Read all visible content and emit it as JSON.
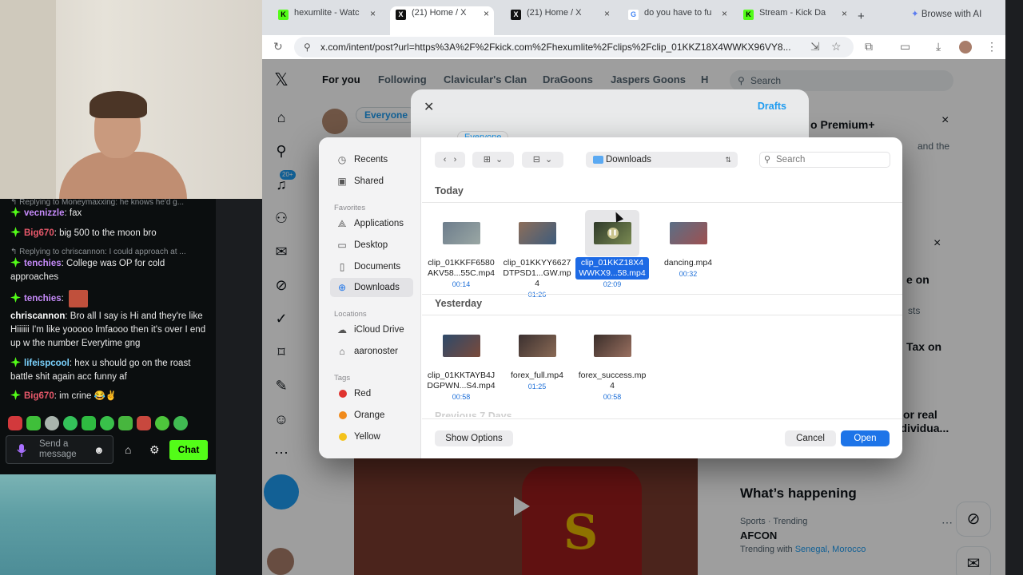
{
  "browser": {
    "tabs": [
      {
        "label": "hexumlite - Watc",
        "favicon": "kick-icon"
      },
      {
        "label": "(21) Home / X",
        "favicon": "x-icon",
        "active": true
      },
      {
        "label": "(21) Home / X",
        "favicon": "x-icon"
      },
      {
        "label": "do you have to fu",
        "favicon": "google-icon"
      },
      {
        "label": "Stream - Kick Da",
        "favicon": "kick-icon"
      }
    ],
    "new_tab": "+",
    "browse_ai": "Browse with AI",
    "url": "x.com/intent/post?url=https%3A%2F%2Fkick.com%2Fhexumlite%2Fclips%2Fclip_01KKZ18X4WWKX96VY8..."
  },
  "x": {
    "tabs": [
      "For you",
      "Following",
      "Clavicular's Clan",
      "DraGoons",
      "Jaspers Goons",
      "H"
    ],
    "search_placeholder": "Search",
    "audience": "Everyone",
    "notif_count": "20+",
    "premium_title": "o Premium+",
    "premium_text": "and the",
    "sidebar_snippets": [
      "e on",
      "sts",
      "Tax on",
      "or real",
      "ndividua..."
    ],
    "whats_happening": "What’s happening",
    "trend_meta": "Sports · Trending",
    "trend_title": "AFCON",
    "trending_with": "Trending with",
    "trend_links": "Senegal, Morocco"
  },
  "compose": {
    "drafts": "Drafts",
    "audience": "Everyone"
  },
  "chat": {
    "messages": [
      {
        "reply": "Replying to Moneymaxxing: he knows he'd g..."
      },
      {
        "user": "vecnizzle",
        "color": "#c58af9",
        "text": ": fax"
      },
      {
        "user": "Big670",
        "color": "#e9596b",
        "text": ": big 500 to the moon bro"
      },
      {
        "reply": "Replying to chriscannon: I could approach at ..."
      },
      {
        "user": "tenchies",
        "color": "#c58af9",
        "text": ": College was OP for cold approaches"
      },
      {
        "user": "tenchies",
        "color": "#c58af9",
        "text": ":"
      },
      {
        "user": "chriscannon",
        "color": "#ffffff",
        "text": ": Bro all I say is Hi and they're like Hiiiiii I'm like yooooo lmfaooo then it's over I end up w the number Everytime gng"
      },
      {
        "user": "lifeispcool",
        "color": "#7bd3ff",
        "text": ": hex u should go on the roast battle shit again acc funny af"
      },
      {
        "user": "Big670",
        "color": "#e9596b",
        "text": ": im crine 😂✌️"
      }
    ],
    "input_placeholder": "Send a message",
    "send_label": "Chat"
  },
  "dialog": {
    "sidebar": {
      "recents": "Recents",
      "shared": "Shared",
      "favorites_head": "Favorites",
      "favorites": [
        "Applications",
        "Desktop",
        "Documents",
        "Downloads"
      ],
      "locations_head": "Locations",
      "locations": [
        "iCloud Drive",
        "aaronoster"
      ],
      "tags_head": "Tags",
      "tags": [
        {
          "name": "Red",
          "color": "#e0332f"
        },
        {
          "name": "Orange",
          "color": "#f08a1c"
        },
        {
          "name": "Yellow",
          "color": "#f4c21b"
        }
      ]
    },
    "location": "Downloads",
    "search_placeholder": "Search",
    "today_head": "Today",
    "yesterday_head": "Yesterday",
    "prev_head": "Previous 7 Days",
    "today_files": [
      {
        "name": "clip_01KKFF6580AKV58...55C.mp4",
        "duration": "00:14"
      },
      {
        "name": "clip_01KKYY6627DTPSD1...GW.mp4",
        "duration": "01:26"
      },
      {
        "name": "clip_01KKZ18X4WWKX9...58.mp4",
        "duration": "02:09",
        "selected": true
      },
      {
        "name": "dancing.mp4",
        "duration": "00:32"
      }
    ],
    "yesterday_files": [
      {
        "name": "clip_01KKTAYB4JDGPWN...S4.mp4",
        "duration": "00:58"
      },
      {
        "name": "forex_full.mp4",
        "duration": "01:25"
      },
      {
        "name": "forex_success.mp4",
        "duration": "00:58"
      }
    ],
    "show_options": "Show Options",
    "cancel": "Cancel",
    "open": "Open"
  },
  "colors": {
    "kick_green": "#53fc18",
    "x_blue": "#1d9bf0",
    "mac_blue": "#1d74e8"
  }
}
